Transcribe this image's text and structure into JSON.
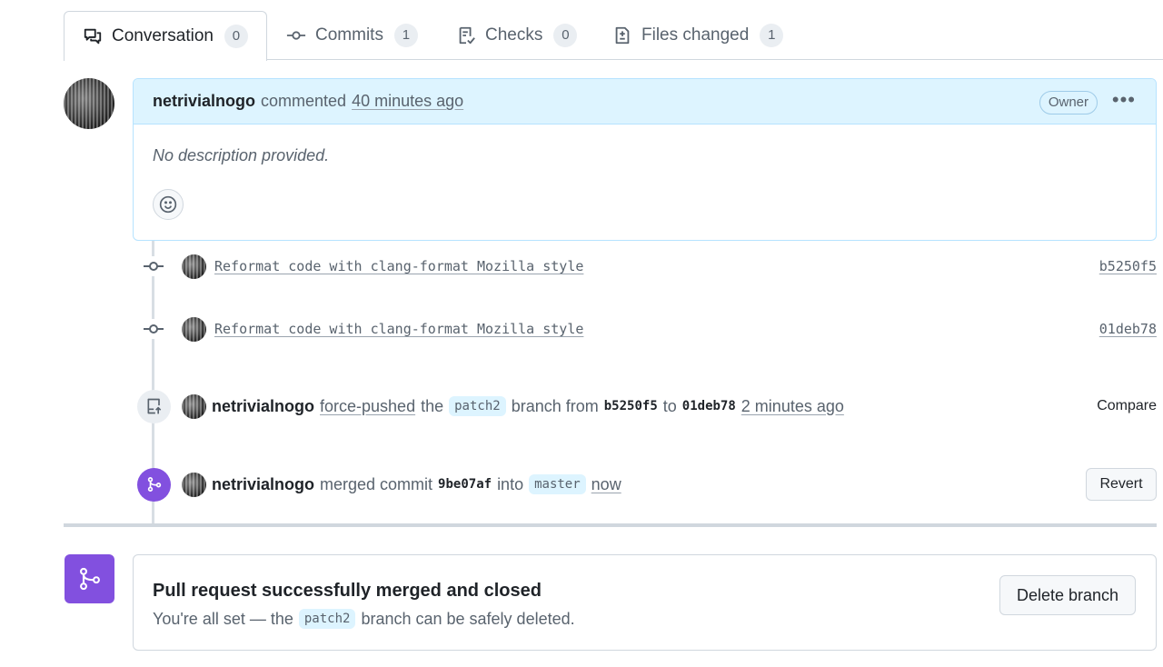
{
  "tabs": [
    {
      "label": "Conversation",
      "count": "0",
      "icon": "comment-discussion-icon"
    },
    {
      "label": "Commits",
      "count": "1",
      "icon": "git-commit-icon"
    },
    {
      "label": "Checks",
      "count": "0",
      "icon": "checklist-icon"
    },
    {
      "label": "Files changed",
      "count": "1",
      "icon": "file-diff-icon"
    }
  ],
  "comment": {
    "author": "netrivialnogo",
    "action": "commented",
    "time": "40 minutes ago",
    "badge": "Owner",
    "more": "•••",
    "body": "No description provided."
  },
  "commits": [
    {
      "message": "Reformat code with clang-format Mozilla style",
      "sha": "b5250f5"
    },
    {
      "message": "Reformat code with clang-format Mozilla style",
      "sha": "01deb78"
    }
  ],
  "force_push": {
    "author": "netrivialnogo",
    "action": "force-pushed",
    "the": "the",
    "branch": "patch2",
    "branch_from": "branch from",
    "from_sha": "b5250f5",
    "to": "to",
    "to_sha": "01deb78",
    "time": "2 minutes ago",
    "compare": "Compare"
  },
  "merge_event": {
    "author": "netrivialnogo",
    "action": "merged commit",
    "sha": "9be07af",
    "into": "into",
    "branch": "master",
    "time": "now",
    "revert": "Revert"
  },
  "merged_box": {
    "title": "Pull request successfully merged and closed",
    "sub_prefix": "You're all set — the",
    "branch": "patch2",
    "sub_suffix": "branch can be safely deleted.",
    "delete_button": "Delete branch"
  },
  "colors": {
    "accent_purple": "#8250df",
    "comment_header_bg": "#ddf4ff",
    "border": "#d0d7de"
  }
}
